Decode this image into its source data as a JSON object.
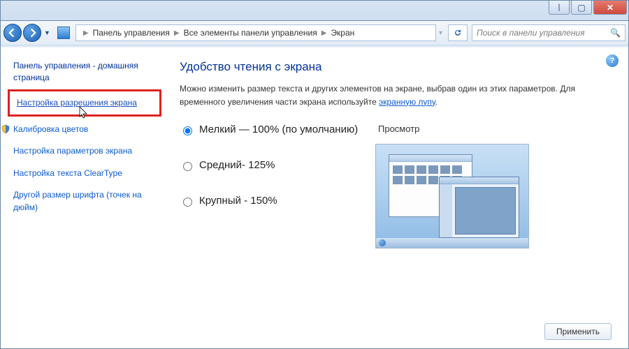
{
  "breadcrumb": {
    "items": [
      "Панель управления",
      "Все элементы панели управления",
      "Экран"
    ]
  },
  "search": {
    "placeholder": "Поиск в панели управления"
  },
  "sidebar": {
    "home": "Панель управления - домашняя страница",
    "links": [
      "Настройка разрешения экрана",
      "Калибровка цветов",
      "Настройка параметров экрана",
      "Настройка текста ClearType",
      "Другой размер шрифта (точек на дюйм)"
    ]
  },
  "main": {
    "title": "Удобство чтения с экрана",
    "desc1": "Можно изменить размер текста и других элементов на экране, выбрав один из этих параметров. Для временного увеличения части экрана используйте ",
    "desc_link": "экранную лупу",
    "desc_tail": ".",
    "options": [
      "Мелкий — 100% (по умолчанию)",
      "Средний- 125%",
      "Крупный - 150%"
    ],
    "preview_label": "Просмотр",
    "apply": "Применить"
  }
}
